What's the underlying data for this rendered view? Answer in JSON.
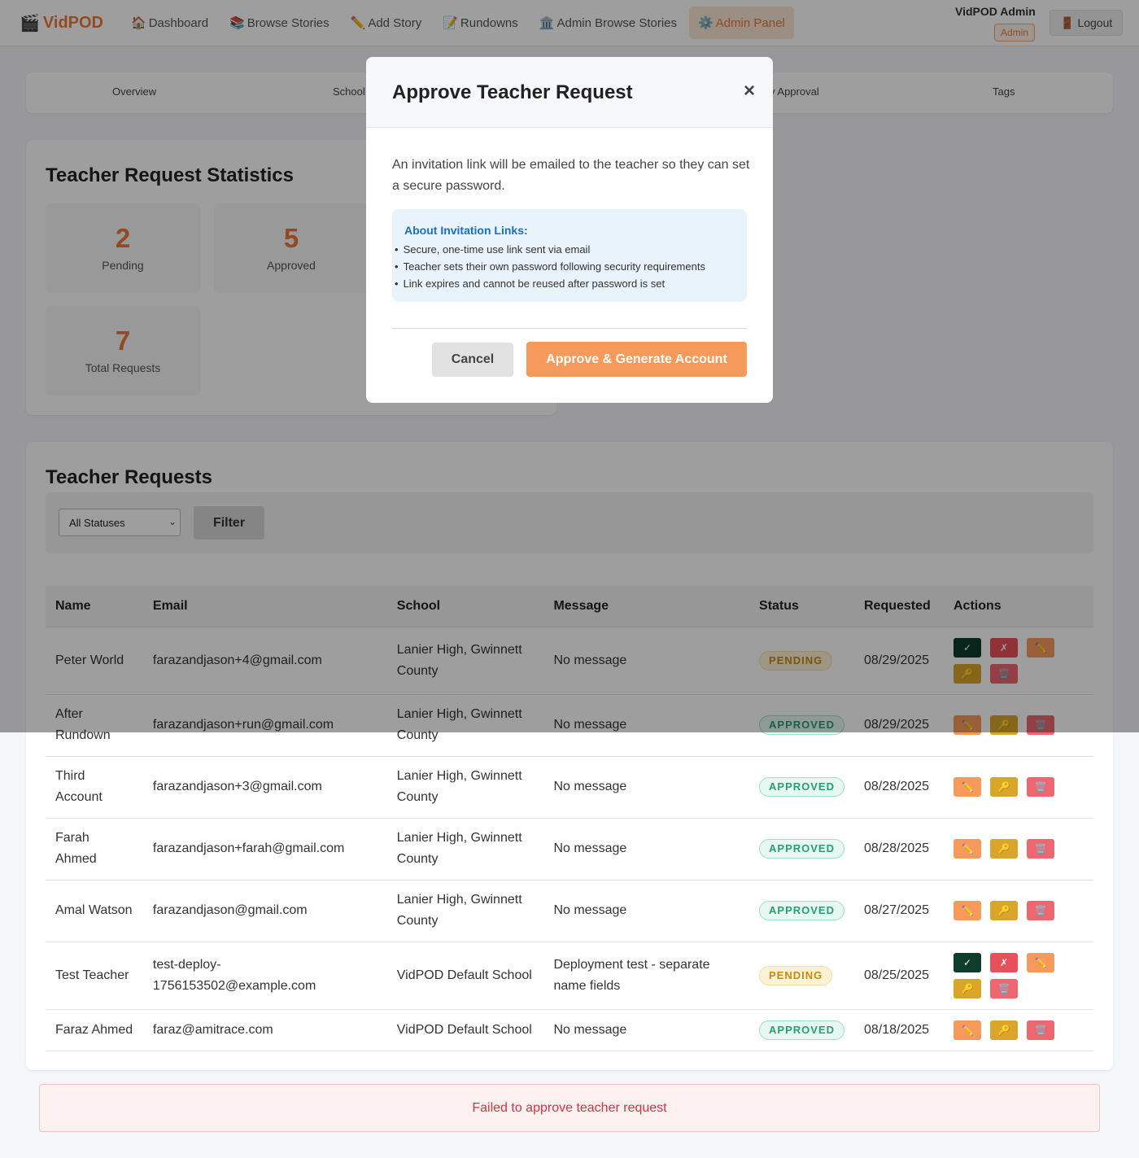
{
  "nav": {
    "brand": "VidPOD",
    "brand_icon": "🎬",
    "links": [
      {
        "icon": "🏠",
        "label": "Dashboard"
      },
      {
        "icon": "📚",
        "label": "Browse Stories"
      },
      {
        "icon": "✏️",
        "label": "Add Story"
      },
      {
        "icon": "📝",
        "label": "Rundowns"
      },
      {
        "icon": "🏛️",
        "label": "Admin Browse Stories"
      },
      {
        "icon": "⚙️",
        "label": "Admin Panel",
        "active": true
      }
    ],
    "user_name": "VidPOD Admin",
    "user_role": "Admin",
    "logout_icon": "🚪",
    "logout_label": "Logout"
  },
  "tabs": [
    "Overview",
    "Schools",
    "Story Approval",
    "Tags"
  ],
  "tabs_visible": {
    "schools_partial": "School",
    "approval_partial": "y Approval"
  },
  "stats": {
    "title": "Teacher Request Statistics",
    "items": [
      {
        "value": "2",
        "label": "Pending"
      },
      {
        "value": "5",
        "label": "Approved"
      },
      {
        "value": "7",
        "label": "Total Requests"
      }
    ]
  },
  "requests": {
    "title": "Teacher Requests",
    "filter_select": "All Statuses",
    "filter_button": "Filter",
    "columns": [
      "Name",
      "Email",
      "School",
      "Message",
      "Status",
      "Requested",
      "Actions"
    ],
    "rows": [
      {
        "name": "Peter World",
        "email": "farazandjason+4@gmail.com",
        "school": "Lanier High, Gwinnett County",
        "message": "No message",
        "status": "PENDING",
        "requested": "08/29/2025"
      },
      {
        "name": "After Rundown",
        "email": "farazandjason+run@gmail.com",
        "school": "Lanier High, Gwinnett County",
        "message": "No message",
        "status": "APPROVED",
        "requested": "08/29/2025"
      },
      {
        "name": "Third Account",
        "email": "farazandjason+3@gmail.com",
        "school": "Lanier High, Gwinnett County",
        "message": "No message",
        "status": "APPROVED",
        "requested": "08/28/2025"
      },
      {
        "name": "Farah Ahmed",
        "email": "farazandjason+farah@gmail.com",
        "school": "Lanier High, Gwinnett County",
        "message": "No message",
        "status": "APPROVED",
        "requested": "08/28/2025"
      },
      {
        "name": "Amal Watson",
        "email": "farazandjason@gmail.com",
        "school": "Lanier High, Gwinnett County",
        "message": "No message",
        "status": "APPROVED",
        "requested": "08/27/2025"
      },
      {
        "name": "Test Teacher",
        "email": "test-deploy-1756153502@example.com",
        "school": "VidPOD Default School",
        "message": "Deployment test - separate name fields",
        "status": "PENDING",
        "requested": "08/25/2025"
      },
      {
        "name": "Faraz Ahmed",
        "email": "faraz@amitrace.com",
        "school": "VidPOD Default School",
        "message": "No message",
        "status": "APPROVED",
        "requested": "08/18/2025"
      }
    ],
    "action_icons": {
      "approve": "✓",
      "reject": "✗",
      "edit": "✏️",
      "reset": "🔑",
      "delete": "🗑️"
    }
  },
  "error_message": "Failed to approve teacher request",
  "modal": {
    "title": "Approve Teacher Request",
    "close": "×",
    "description": "An invitation link will be emailed to the teacher so they can set a secure password.",
    "info_title": "About Invitation Links:",
    "info_items": [
      "Secure, one-time use link sent via email",
      "Teacher sets their own password following security requirements",
      "Link expires and cannot be reused after password is set"
    ],
    "cancel": "Cancel",
    "approve": "Approve & Generate Account"
  },
  "colors": {
    "accent": "#e8793a",
    "approve_button": "#f59a5b",
    "error": "#d0363f"
  }
}
